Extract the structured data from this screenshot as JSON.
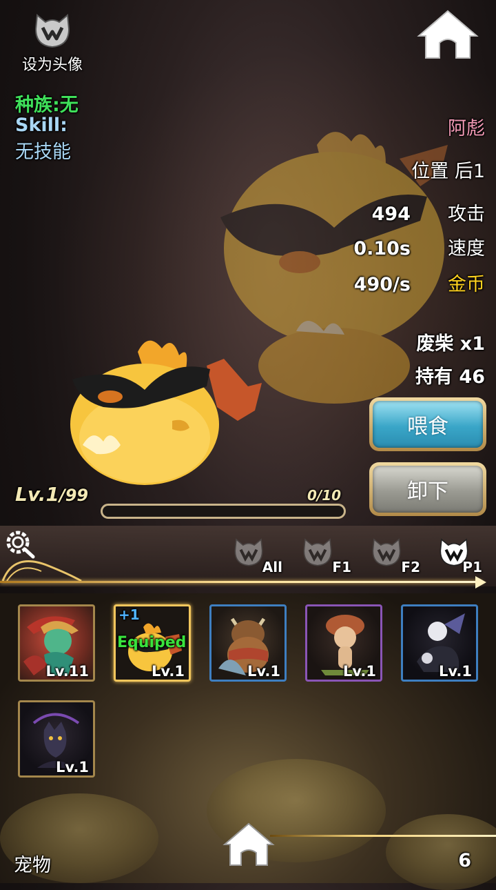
{
  "header": {
    "avatar_label": "设为头像",
    "home_icon": "home-icon"
  },
  "pet_info": {
    "race": "种族:无",
    "skill_label": "Skill:",
    "skill_value": "无技能",
    "name": "阿彪",
    "position": "位置 后1"
  },
  "stats": [
    {
      "value": "494",
      "label": "攻击",
      "label_color": "#ffffff"
    },
    {
      "value": "0.10s",
      "label": "速度",
      "label_color": "#ffffff"
    },
    {
      "value": "490/s",
      "label": "金币",
      "label_color": "#ffd21f"
    }
  ],
  "inventory": {
    "item": "废柴 x1",
    "owned": "持有 46"
  },
  "buttons": {
    "feed": "喂食",
    "unload": "卸下"
  },
  "level": {
    "current": "Lv.1",
    "max": "/99",
    "exp": "0/10",
    "exp_fraction": 0
  },
  "filters": [
    {
      "label": "All",
      "active": false
    },
    {
      "label": "F1",
      "active": false
    },
    {
      "label": "F2",
      "active": false
    },
    {
      "label": "P1",
      "active": true
    }
  ],
  "pets": [
    {
      "level": "Lv.11",
      "border": "#a4874c",
      "art": "red-dragon-rider",
      "plus": "",
      "equipped": ""
    },
    {
      "level": "Lv.1",
      "border": "#f2c65c",
      "art": "yellow-chick-sunglasses",
      "plus": "+1",
      "equipped": "Equiped"
    },
    {
      "level": "Lv.1",
      "border": "#3e7fc1",
      "art": "brown-bear-warrior",
      "plus": "",
      "equipped": ""
    },
    {
      "level": "Lv.1",
      "border": "#8a55b6",
      "art": "mushroom-kid",
      "plus": "",
      "equipped": ""
    },
    {
      "level": "Lv.1",
      "border": "#3e7fc1",
      "art": "dark-ghost-beast",
      "plus": "",
      "equipped": ""
    },
    {
      "level": "Lv.1",
      "border": "#a4874c",
      "art": "shadow-cat",
      "plus": "",
      "equipped": ""
    }
  ],
  "bottom": {
    "title": "宠物",
    "count": "6"
  }
}
